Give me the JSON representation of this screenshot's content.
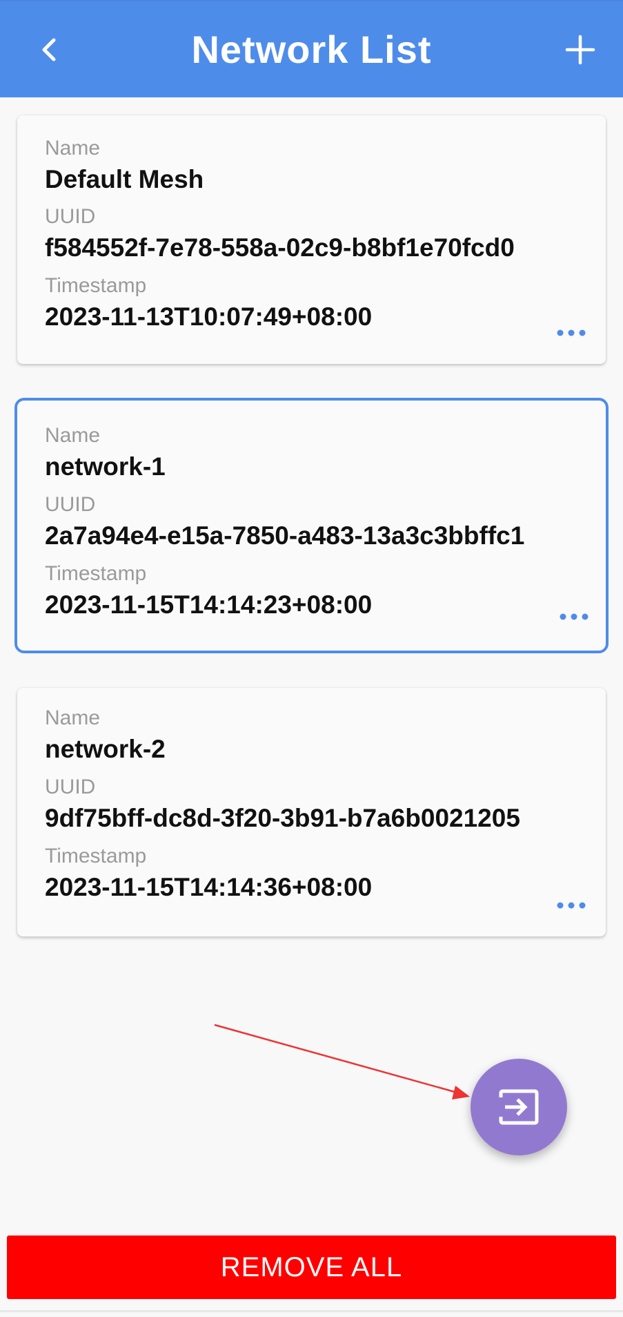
{
  "header": {
    "title": "Network List",
    "back_icon": "chevron-left-icon",
    "add_icon": "plus-icon",
    "background_color": "#4e8cea"
  },
  "labels": {
    "name": "Name",
    "uuid": "UUID",
    "timestamp": "Timestamp"
  },
  "networks": [
    {
      "name": "Default Mesh",
      "uuid": "f584552f-7e78-558a-02c9-b8bf1e70fcd0",
      "timestamp": "2023-11-13T10:07:49+08:00",
      "selected": false
    },
    {
      "name": "network-1",
      "uuid": "2a7a94e4-e15a-7850-a483-13a3c3bbffc1",
      "timestamp": "2023-11-15T14:14:23+08:00",
      "selected": true
    },
    {
      "name": "network-2",
      "uuid": "9df75bff-dc8d-3f20-3b91-b7a6b0021205",
      "timestamp": "2023-11-15T14:14:36+08:00",
      "selected": false
    }
  ],
  "fab": {
    "icon": "import-icon",
    "color": "#9279d0"
  },
  "footer": {
    "remove_all_label": "REMOVE ALL",
    "color": "#ff0000"
  },
  "accent_color": "#4e8cea"
}
